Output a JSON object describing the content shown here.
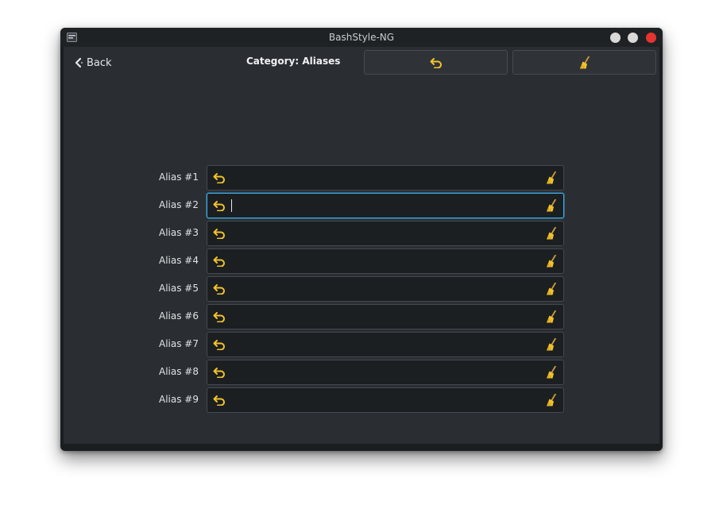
{
  "window": {
    "title": "BashStyle-NG"
  },
  "header": {
    "back_label": "Back",
    "category_title": "Category: Aliases"
  },
  "aliases": [
    {
      "label": "Alias #1",
      "value": "",
      "focused": false
    },
    {
      "label": "Alias #2",
      "value": "",
      "focused": true
    },
    {
      "label": "Alias #3",
      "value": "",
      "focused": false
    },
    {
      "label": "Alias #4",
      "value": "",
      "focused": false
    },
    {
      "label": "Alias #5",
      "value": "",
      "focused": false
    },
    {
      "label": "Alias #6",
      "value": "",
      "focused": false
    },
    {
      "label": "Alias #7",
      "value": "",
      "focused": false
    },
    {
      "label": "Alias #8",
      "value": "",
      "focused": false
    },
    {
      "label": "Alias #9",
      "value": "",
      "focused": false
    }
  ],
  "colors": {
    "accent_focus": "#3daee9",
    "icon_yellow": "#f2c22a",
    "close_button": "#e5342f",
    "panel_background": "#2a2e33"
  },
  "icons": {
    "undo": "undo-arrow-icon",
    "clear": "broom-icon",
    "back": "chevron-left-icon",
    "app": "app-icon"
  }
}
